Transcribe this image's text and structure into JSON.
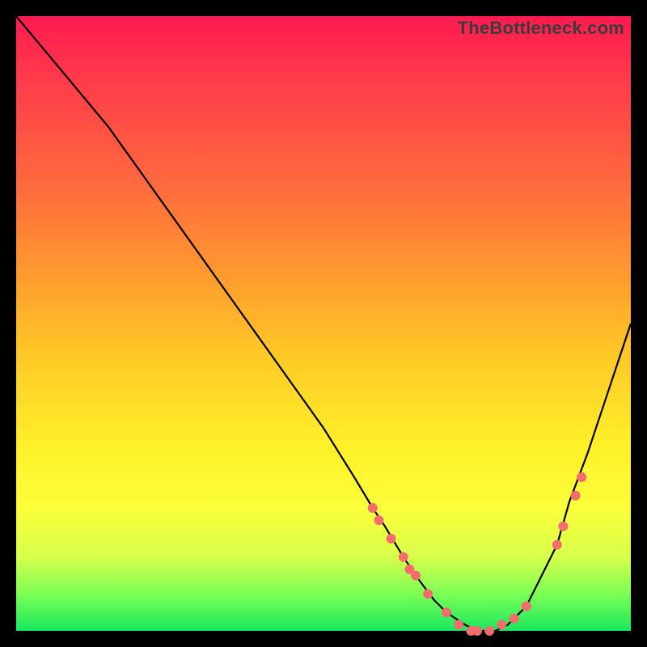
{
  "watermark": "TheBottleneck.com",
  "colors": {
    "curve_stroke": "#000000",
    "marker_fill": "#f36d6d",
    "marker_stroke": "#f36d6d"
  },
  "chart_data": {
    "type": "line",
    "title": "",
    "xlabel": "",
    "ylabel": "",
    "xlim": [
      0,
      100
    ],
    "ylim": [
      0,
      100
    ],
    "series": [
      {
        "name": "bottleneck-curve",
        "x": [
          0,
          5,
          10,
          15,
          20,
          25,
          30,
          35,
          40,
          45,
          50,
          55,
          58,
          60,
          63,
          65,
          68,
          70,
          73,
          75,
          78,
          80,
          83,
          85,
          88,
          90,
          93,
          96,
          100
        ],
        "y": [
          100,
          94,
          88,
          82,
          75,
          68,
          61,
          54,
          47,
          40,
          33,
          25,
          20,
          17,
          12,
          9,
          5,
          3,
          1,
          0,
          0,
          1,
          4,
          8,
          14,
          21,
          29,
          38,
          50
        ]
      }
    ],
    "markers": [
      {
        "x": 58,
        "y": 20
      },
      {
        "x": 59,
        "y": 18
      },
      {
        "x": 61,
        "y": 15
      },
      {
        "x": 63,
        "y": 12
      },
      {
        "x": 64,
        "y": 10
      },
      {
        "x": 65,
        "y": 9
      },
      {
        "x": 67,
        "y": 6
      },
      {
        "x": 70,
        "y": 3
      },
      {
        "x": 72,
        "y": 1
      },
      {
        "x": 74,
        "y": 0
      },
      {
        "x": 75,
        "y": 0
      },
      {
        "x": 77,
        "y": 0
      },
      {
        "x": 79,
        "y": 1
      },
      {
        "x": 81,
        "y": 2
      },
      {
        "x": 83,
        "y": 4
      },
      {
        "x": 88,
        "y": 14
      },
      {
        "x": 89,
        "y": 17
      },
      {
        "x": 91,
        "y": 22
      },
      {
        "x": 92,
        "y": 25
      }
    ]
  }
}
